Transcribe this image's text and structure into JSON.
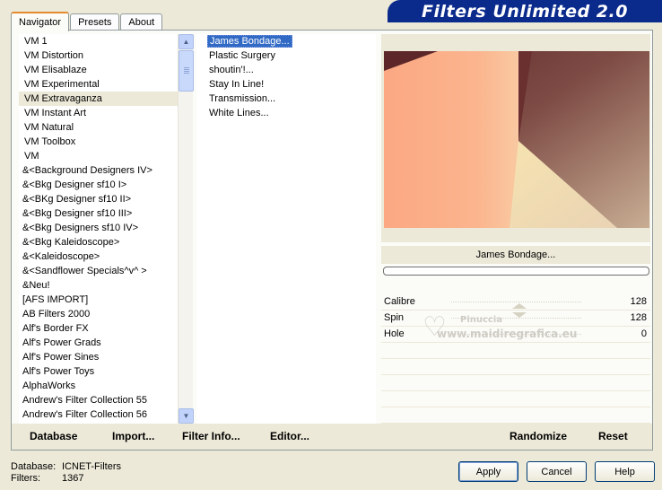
{
  "app": {
    "banner_title": "Filters Unlimited 2.0"
  },
  "tabs": [
    {
      "label": "Navigator",
      "active": true
    },
    {
      "label": "Presets",
      "active": false
    },
    {
      "label": "About",
      "active": false
    }
  ],
  "categories": [
    "VM 1",
    "VM Distortion",
    "VM Elisablaze",
    "VM Experimental",
    "VM Extravaganza",
    "VM Instant Art",
    "VM Natural",
    "VM Toolbox",
    "VM",
    "&<Background Designers IV>",
    "&<Bkg Designer sf10 I>",
    "&<BKg Designer sf10 II>",
    "&<Bkg Designer sf10 III>",
    "&<Bkg Designers sf10 IV>",
    "&<Bkg Kaleidoscope>",
    "&<Kaleidoscope>",
    "&<Sandflower Specials^v^ >",
    "&Neu!",
    "[AFS IMPORT]",
    "AB Filters 2000",
    "Alf's Border FX",
    "Alf's Power Grads",
    "Alf's Power Sines",
    "Alf's Power Toys",
    "AlphaWorks",
    "Andrew's Filter Collection 55",
    "Andrew's Filter Collection 56"
  ],
  "selected_category_index": 4,
  "filters": [
    "James Bondage...",
    "Plastic Surgery",
    "shoutin'!...",
    "Stay In Line!",
    "Transmission...",
    "White Lines..."
  ],
  "selected_filter": "James Bondage...",
  "params": [
    {
      "label": "Calibre",
      "value": "128"
    },
    {
      "label": "Spin",
      "value": "128"
    },
    {
      "label": "Hole",
      "value": "0"
    }
  ],
  "watermark": {
    "name": "Pinuccia",
    "url": "www.maidiregrafica.eu"
  },
  "panel_buttons": {
    "database": "Database",
    "import": "Import...",
    "filter_info": "Filter Info...",
    "editor": "Editor...",
    "randomize": "Randomize",
    "reset": "Reset"
  },
  "footer": {
    "database_label": "Database:",
    "database_value": "ICNET-Filters",
    "filters_label": "Filters:",
    "filters_value": "1367",
    "apply": "Apply",
    "cancel": "Cancel",
    "help": "Help"
  },
  "colors": {
    "banner": "#0a2a8c",
    "selection": "#316ac5",
    "tab_highlight": "#e68b2c"
  },
  "icons": {
    "scroll_up": "chevron-up-icon",
    "scroll_down": "chevron-down-icon"
  }
}
